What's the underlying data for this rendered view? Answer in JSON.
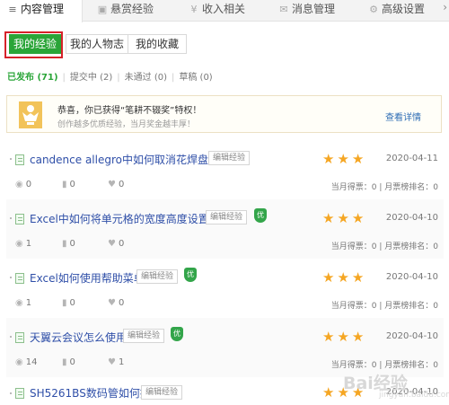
{
  "topnav": {
    "tabs": [
      {
        "label": "内容管理",
        "icon": "list-icon"
      },
      {
        "label": "悬赏经验",
        "icon": "bag-icon"
      },
      {
        "label": "收入相关",
        "icon": "coin-icon"
      },
      {
        "label": "消息管理",
        "icon": "mail-icon"
      },
      {
        "label": "高级设置",
        "icon": "gear-icon"
      }
    ],
    "more": "›"
  },
  "subtabs": [
    "我的经验",
    "我的人物志",
    "我的收藏"
  ],
  "filters": [
    "已发布 (71)",
    "提交中 (2)",
    "未通过 (0)",
    "草稿 (0)"
  ],
  "notice": {
    "line1": "恭喜，你已获得“笔耕不辍奖”特权！",
    "line2": "创作越多优质经验，当月奖金越丰厚！",
    "detail": "查看详情"
  },
  "edit_label": "编辑经验",
  "badge_label": "优",
  "votes_label": "当月得票：0 | 月票榜排名：0",
  "articles": [
    {
      "title": "candence allegro中如何取消花焊盘(十...",
      "date": "2020-04-11",
      "views": "0",
      "comments": "0",
      "likes": "0",
      "stars": "★★★"
    },
    {
      "title": "Excel中如何将单元格的宽度高度设置成...",
      "date": "2020-04-10",
      "views": "1",
      "comments": "0",
      "likes": "0",
      "stars": "★★★"
    },
    {
      "title": "Excel如何使用帮助菜单",
      "date": "2020-04-10",
      "views": "1",
      "comments": "0",
      "likes": "0",
      "stars": "★★★"
    },
    {
      "title": "天翼云会议怎么使用",
      "date": "2020-04-10",
      "views": "14",
      "comments": "0",
      "likes": "1",
      "stars": "★★★"
    },
    {
      "title": "SH5261BS数码管如何接",
      "date": "2020-04-10",
      "stars": "★★★"
    }
  ],
  "watermark": {
    "main": "Bai经验",
    "sub": "jingyan.baidu.com"
  },
  "colors": {
    "accent": "#2aa538",
    "link": "#2f4fa8",
    "star": "#f5a623",
    "highlight": "#d6222a"
  }
}
